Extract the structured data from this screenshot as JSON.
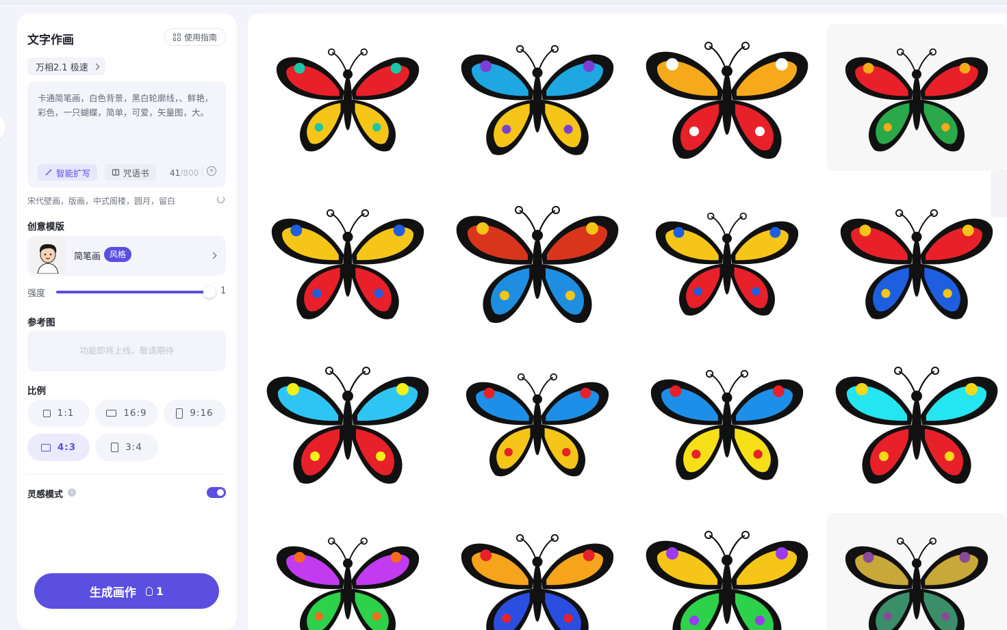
{
  "panel": {
    "title": "文字作画",
    "guide_label": "使用指南",
    "model_label": "万相2.1 极速",
    "prompt_text": "卡通简笔画，白色背景，黑白轮廓线，、鲜艳，彩色，一只蝴蝶，简单，可爱，矢量图，大。",
    "expand_label": "智能扩写",
    "spellbook_label": "咒语书",
    "char_count": "41",
    "char_max": "/800",
    "suggestion": "宋代壁画，版画，中式阁楼，圆月，留白",
    "template_section": "创意模版",
    "template_name": "简笔画",
    "template_badge": "风格",
    "strength_label": "强度",
    "strength_value": "1",
    "strength_fraction": 1.0,
    "reference_section": "参考图",
    "reference_placeholder": "功能即将上线，敬请期待",
    "ratio_section": "比例",
    "ratios": [
      "1:1",
      "16:9",
      "9:16",
      "4:3",
      "3:4"
    ],
    "active_ratio": "4:3",
    "inspiration_label": "灵感模式",
    "inspiration_on": true,
    "generate_label": "生成画作",
    "generate_cost": "1"
  },
  "colors": {
    "accent": "#5b4fe0",
    "panel_bg": "#ffffff",
    "page_bg": "#f3f4fb"
  },
  "gallery": {
    "images": [
      {
        "subject": "butterfly-image",
        "colors": [
          "#111111",
          "#e8202a",
          "#f5c518",
          "#19c6a7"
        ]
      },
      {
        "subject": "butterfly-image",
        "colors": [
          "#111111",
          "#1ea7e1",
          "#f5c518",
          "#7b3fd6"
        ]
      },
      {
        "subject": "butterfly-image",
        "colors": [
          "#111111",
          "#f5a91b",
          "#e8202a",
          "#ffffff"
        ]
      },
      {
        "subject": "butterfly-image",
        "colors": [
          "#111111",
          "#e8202a",
          "#2aa84a",
          "#f5a91b"
        ]
      },
      {
        "subject": "butterfly-image",
        "colors": [
          "#111111",
          "#f5c518",
          "#e8202a",
          "#1e5fe0"
        ]
      },
      {
        "subject": "butterfly-image",
        "colors": [
          "#111111",
          "#d9341c",
          "#1e8fe0",
          "#f5c518"
        ]
      },
      {
        "subject": "butterfly-image",
        "colors": [
          "#111111",
          "#f5c518",
          "#e8202a",
          "#1e5fe0"
        ]
      },
      {
        "subject": "butterfly-image",
        "colors": [
          "#111111",
          "#e8202a",
          "#1e5fe0",
          "#f5c518"
        ]
      },
      {
        "subject": "butterfly-image",
        "colors": [
          "#111111",
          "#2ec5f5",
          "#e8202a",
          "#f5f018"
        ]
      },
      {
        "subject": "butterfly-image",
        "colors": [
          "#111111",
          "#1e8fe8",
          "#f5c518",
          "#e8202a"
        ]
      },
      {
        "subject": "butterfly-image",
        "colors": [
          "#111111",
          "#1e8fe8",
          "#f5e018",
          "#e8202a"
        ]
      },
      {
        "subject": "butterfly-image",
        "colors": [
          "#111111",
          "#25e6f0",
          "#e8202a",
          "#f5d818"
        ]
      },
      {
        "subject": "butterfly-image",
        "colors": [
          "#111111",
          "#c23bf0",
          "#2ed14a",
          "#f56b1b"
        ]
      },
      {
        "subject": "butterfly-image",
        "colors": [
          "#111111",
          "#f5a41b",
          "#2a4fe0",
          "#e8202a"
        ]
      },
      {
        "subject": "butterfly-image",
        "colors": [
          "#111111",
          "#f5c518",
          "#2ed14a",
          "#9b3bf0"
        ]
      },
      {
        "subject": "butterfly-image",
        "colors": [
          "#111111",
          "#c9a83a",
          "#3a8f6a",
          "#8a4a9a"
        ]
      }
    ]
  }
}
